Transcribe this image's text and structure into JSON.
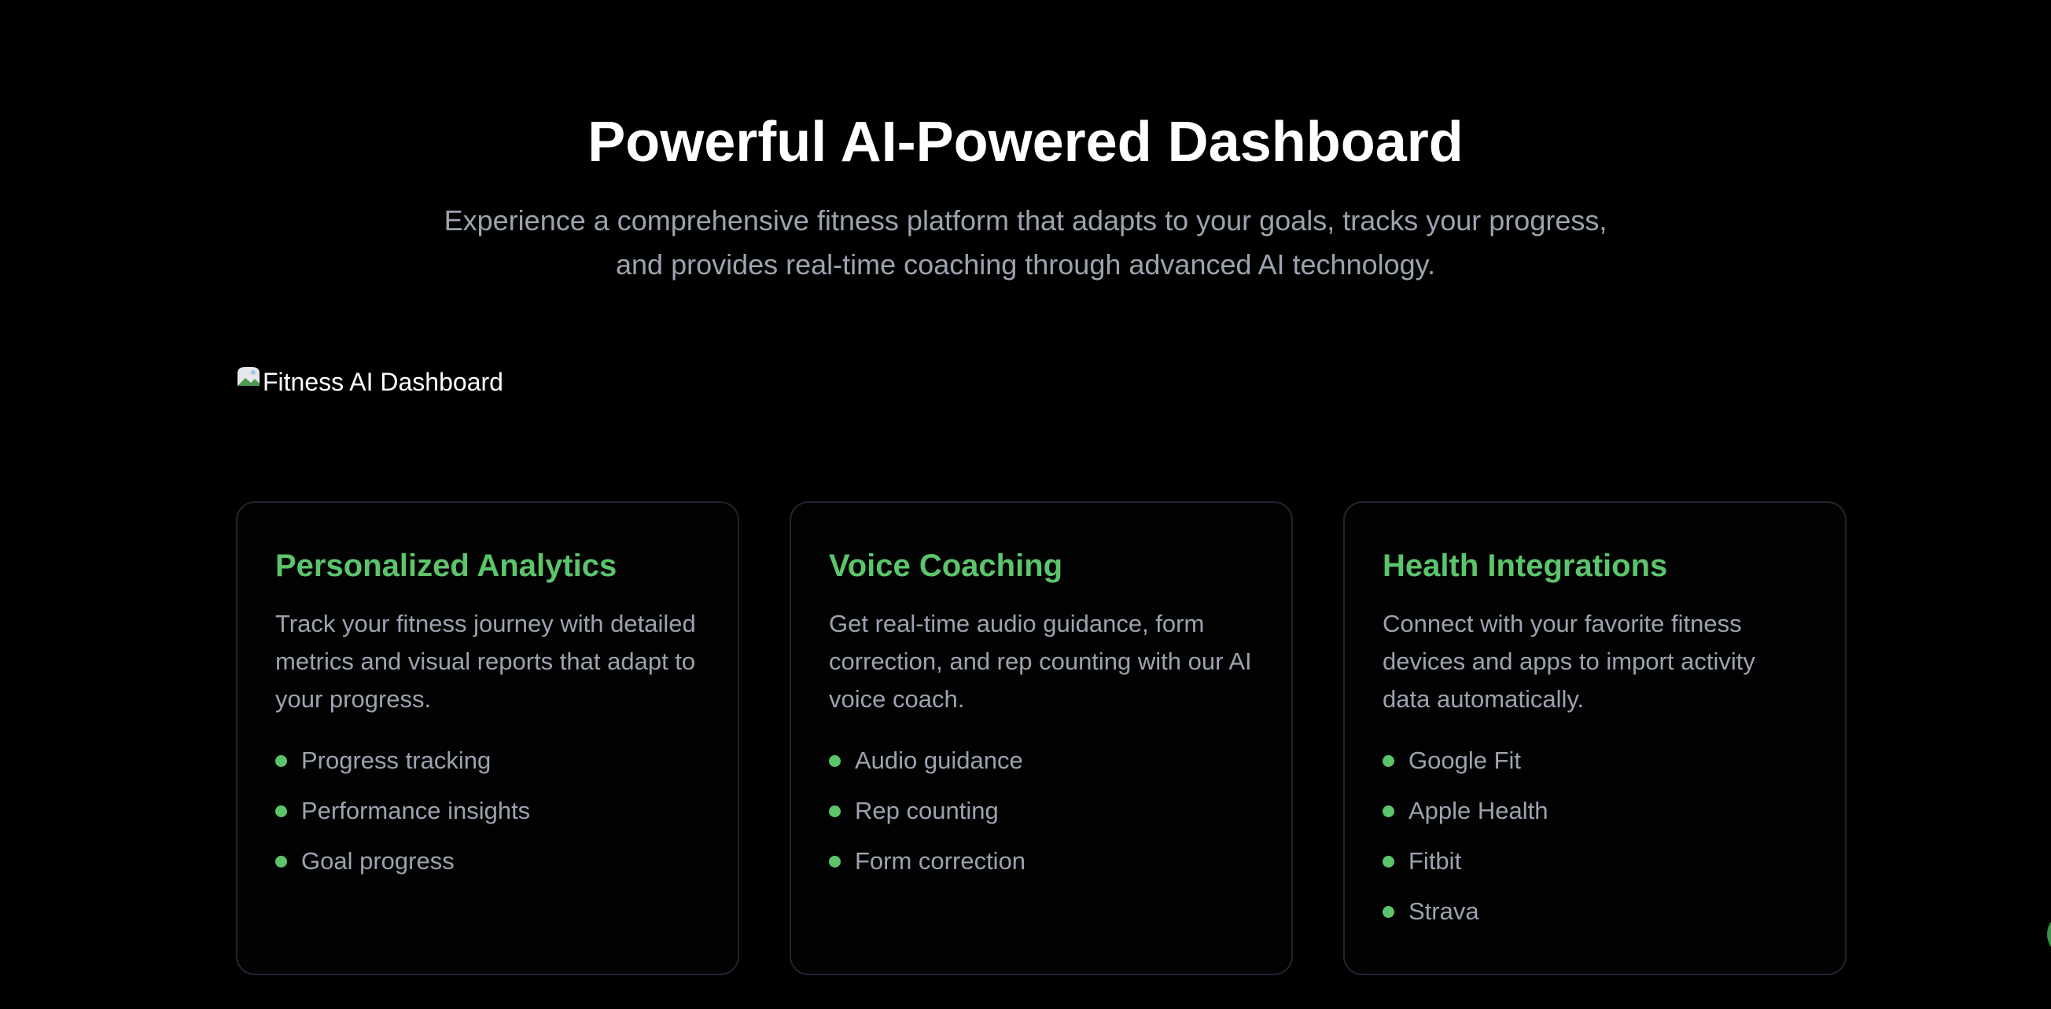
{
  "header": {
    "title": "Powerful AI-Powered Dashboard",
    "subtitle_line1": "Experience a comprehensive fitness platform that adapts to your goals, tracks your progress,",
    "subtitle_line2": "and provides real-time coaching through advanced AI technology."
  },
  "dashboard_image": {
    "alt": "Fitness AI Dashboard",
    "icon": "broken-image-icon"
  },
  "cards": [
    {
      "title": "Personalized Analytics",
      "description": "Track your fitness journey with detailed metrics and visual reports that adapt to your progress.",
      "features": [
        "Progress tracking",
        "Performance insights",
        "Goal progress"
      ]
    },
    {
      "title": "Voice Coaching",
      "description": "Get real-time audio guidance, form correction, and rep counting with our AI voice coach.",
      "features": [
        "Audio guidance",
        "Rep counting",
        "Form correction"
      ]
    },
    {
      "title": "Health Integrations",
      "description": "Connect with your favorite fitness devices and apps to import activity data automatically.",
      "features": [
        "Google Fit",
        "Apple Health",
        "Fitbit",
        "Strava"
      ]
    }
  ],
  "colors": {
    "background": "#000000",
    "accent": "#5cc56b",
    "muted_text": "#9ca3af",
    "card_border": "#1f2530"
  }
}
